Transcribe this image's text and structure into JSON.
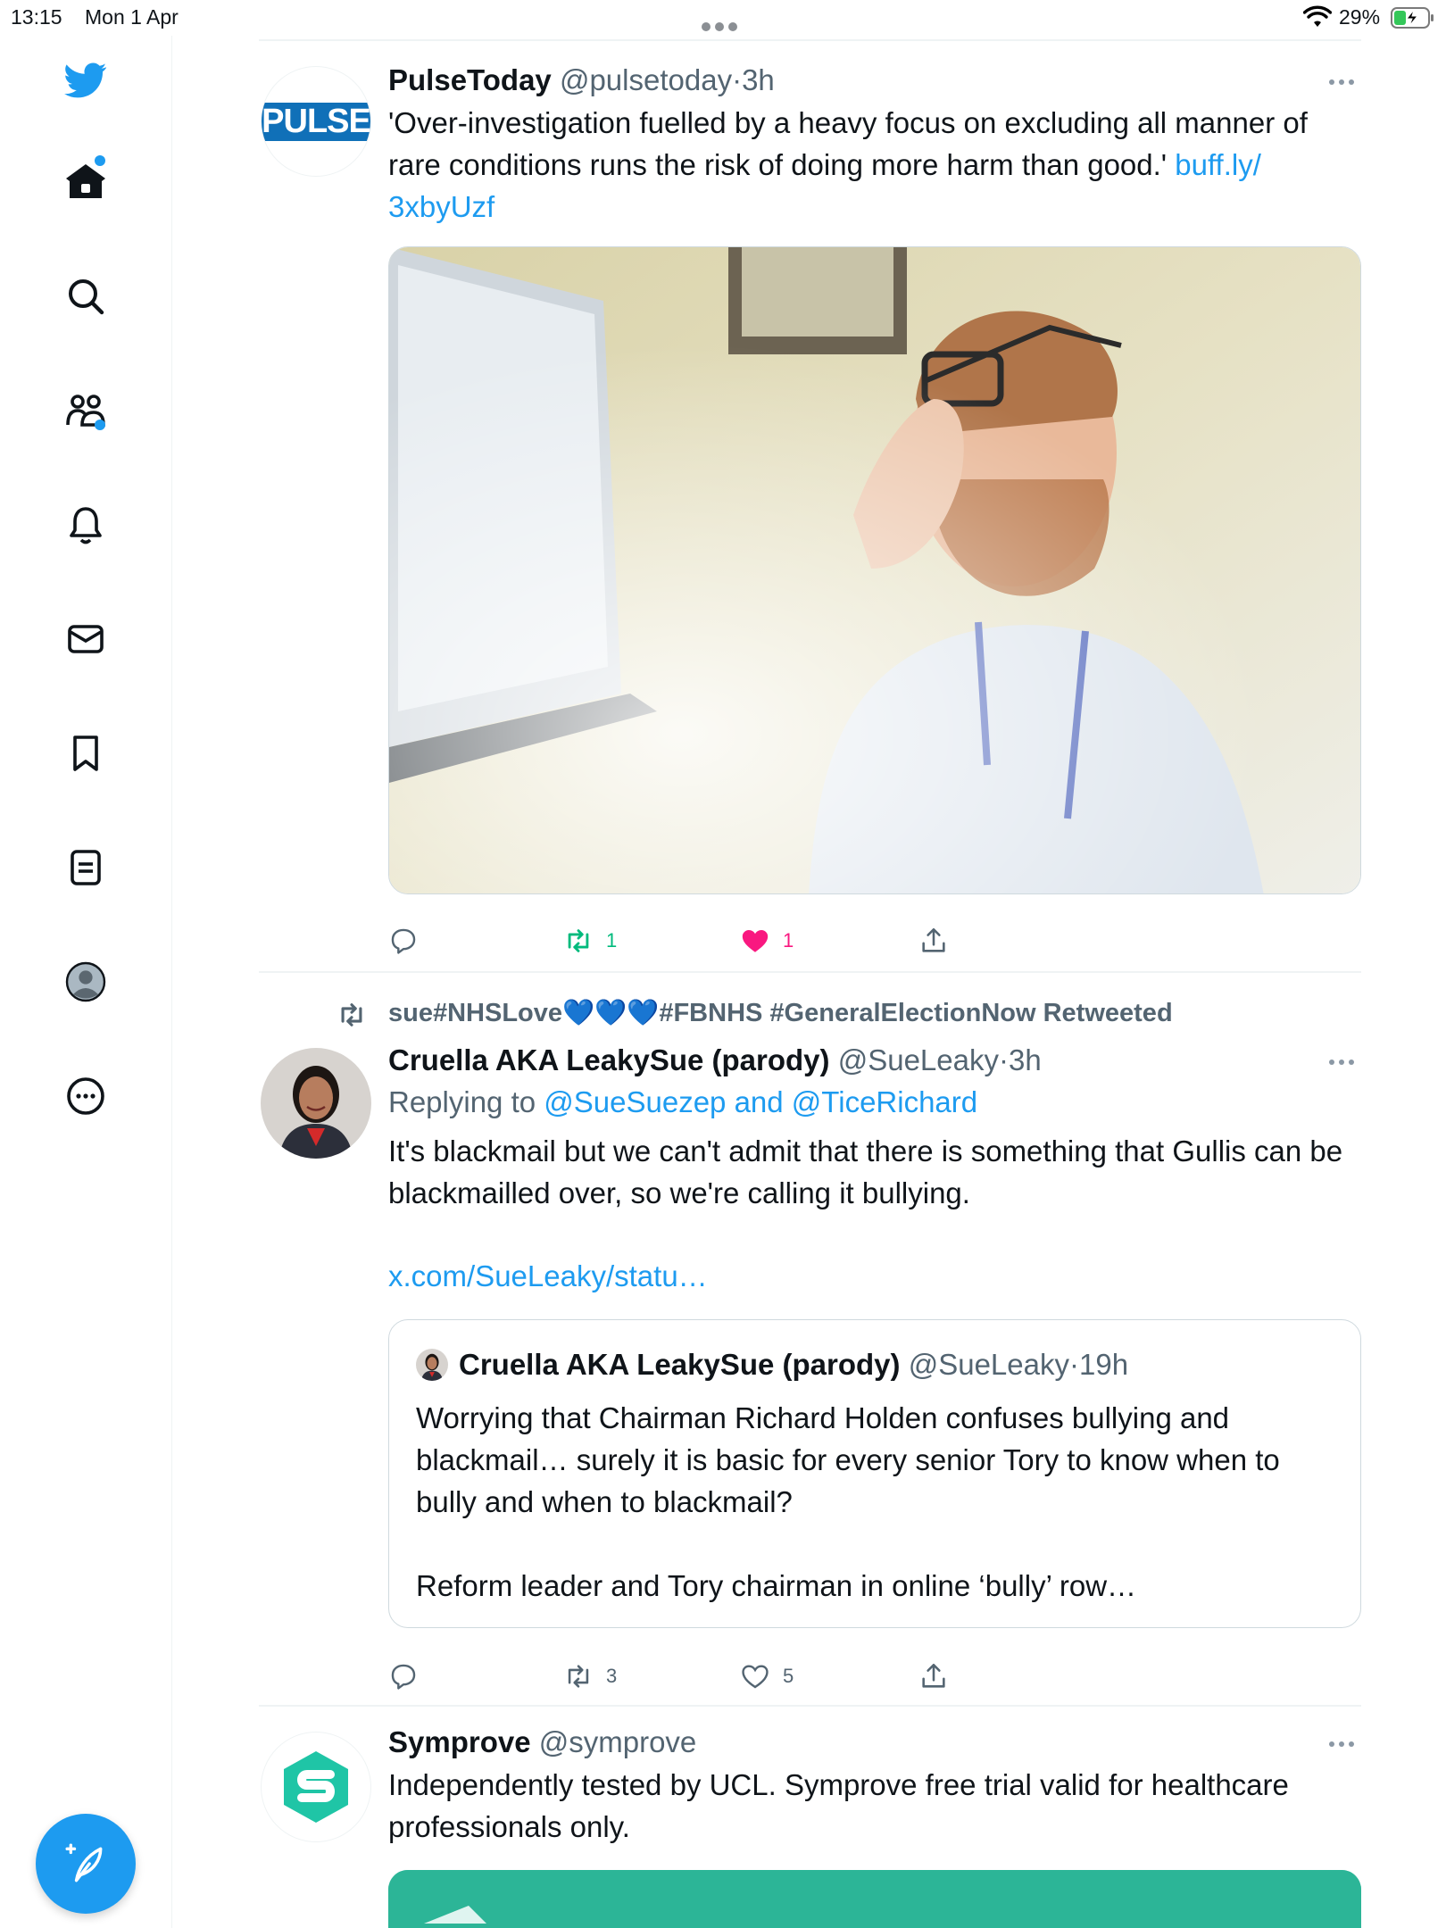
{
  "status_bar": {
    "time": "13:15",
    "date": "Mon 1 Apr",
    "battery": "29%"
  },
  "sidebar": {
    "items": [
      {
        "name": "twitter-logo-icon"
      },
      {
        "name": "home-icon",
        "has_dot": true
      },
      {
        "name": "explore-search-icon"
      },
      {
        "name": "communities-icon",
        "has_dot": true
      },
      {
        "name": "notifications-bell-icon"
      },
      {
        "name": "messages-envelope-icon"
      },
      {
        "name": "bookmarks-icon"
      },
      {
        "name": "lists-icon"
      },
      {
        "name": "profile-avatar-icon"
      },
      {
        "name": "more-circle-icon"
      }
    ],
    "compose_icon": "compose-feather-icon"
  },
  "colors": {
    "accent": "#1d9bf0",
    "retweet_green": "#00ba7c",
    "like_pink": "#f91880",
    "muted": "#536471"
  },
  "tweets": [
    {
      "name": "PulseToday",
      "handle": "@pulsetoday",
      "sep": "·",
      "time": "3h",
      "avatar_text": "PULSE",
      "text": "'Over-investigation fuelled by a heavy focus on excluding all manner of rare conditions runs the risk of doing more harm than good.' ",
      "link": "buff.ly/3xbyUzf",
      "link_part1": "buff.ly/",
      "link_part2": "3xbyUzf",
      "image_icon": "doctor-photo",
      "retweets": "1",
      "likes": "1",
      "liked": true,
      "retweeted": true
    },
    {
      "retweeted_by": "sue#NHSLove💙💙💙#FBNHS #GeneralElectionNow Retweeted",
      "name": "Cruella AKA LeakySue (parody)",
      "handle": "@SueLeaky",
      "sep": "·",
      "time": "3h",
      "replying_prefix": "Replying to ",
      "replying_to": "@SueSuezep and @TiceRichard",
      "text_line1": "It's blackmail but we can't admit that there is something that Gullis can be blackmailled over, so we're calling it bullying.",
      "link": "x.com/SueLeaky/statu…",
      "quote": {
        "name": "Cruella AKA LeakySue (parody)",
        "handle": "@SueLeaky",
        "sep": "·",
        "time": "19h",
        "text": "Worrying that Chairman Richard Holden confuses bullying and blackmail… surely it is basic for every senior Tory to know when to bully and when to blackmail?",
        "text2": "Reform leader and Tory chairman in online ‘bully’ row…"
      },
      "retweets": "3",
      "likes": "5"
    },
    {
      "name": "Symprove",
      "handle": "@symprove",
      "text": "Independently tested by UCL. Symprove free trial valid for healthcare professionals only."
    }
  ]
}
